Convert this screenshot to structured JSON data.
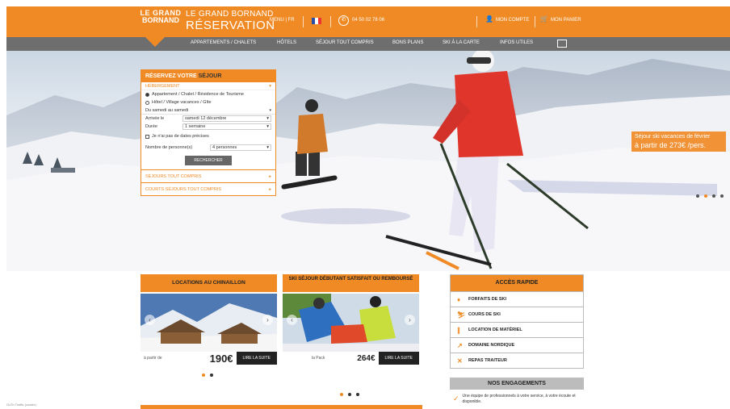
{
  "colors": {
    "accent": "#f08a24",
    "nav": "#6e6e6e",
    "dark": "#222222"
  },
  "header": {
    "logo_line1": "LE GRAND",
    "logo_line2": "BORNAND",
    "brand_line1": "LE GRAND BORNAND",
    "brand_line2": "RÉSERVATION",
    "lang_label": "MENU | FR",
    "phone_icon": "phone-icon",
    "phone": "04 50 02 78 06",
    "account_label": "MON COMPTE",
    "cart_label": "MON PANIER"
  },
  "nav": {
    "items": [
      "APPARTEMENTS / CHALETS",
      "HÔTELS",
      "SÉJOUR TOUT COMPRIS",
      "BONS PLANS",
      "SKI À LA CARTE",
      "INFOS UTILES"
    ]
  },
  "hero": {
    "promo_line1": "Séjour ski vacances de février",
    "promo_line2": "à partir de 273€ /pers.",
    "slides": 4,
    "active_slide": 2
  },
  "booking": {
    "title_prefix": "RÉSERVEZ VOTRE",
    "title_emph": "SÉJOUR",
    "section_label": "HÉBERGEMENT",
    "radio1": "Appartement / Chalet / Résidence de Tourisme",
    "radio2": "Hôtel / Village vacances / Gîte",
    "period_select": "Du samedi au samedi",
    "arrival_label": "Arrivée le",
    "arrival_value": "samedi 12 décembre",
    "duration_label": "Durée",
    "duration_value": "1 semaine",
    "dates_check": "Je n'ai pas de dates précises",
    "people_label": "Nombre de personne(s)",
    "people_value": "4 personnes",
    "search_button": "RECHERCHER",
    "link1": "SÉJOURS TOUT COMPRIS",
    "link2": "COURTS SÉJOURS TOUT COMPRIS"
  },
  "cards": [
    {
      "title": "LOCATIONS AU CHINAILLON",
      "price_prefix": "à partir de",
      "price": "190€",
      "read_more": "LIRE LA SUITE"
    },
    {
      "title": "SKI SÉJOUR DÉBUTANT SATISFAIT OU REMBOURSÉ",
      "price_prefix": "la Pack",
      "price": "264€",
      "read_more": "LIRE LA SUITE"
    }
  ],
  "quick_access": {
    "title": "ACCÈS RAPIDE",
    "items": [
      {
        "label": "FORFAITS DE SKI",
        "icon": "ski-pass-icon",
        "glyph": "♦"
      },
      {
        "label": "COURS DE SKI",
        "icon": "ski-lesson-icon",
        "glyph": "⛷"
      },
      {
        "label": "LOCATION DE MATÉRIEL",
        "icon": "ski-rental-icon",
        "glyph": "∥"
      },
      {
        "label": "DOMAINE NORDIQUE",
        "icon": "nordic-icon",
        "glyph": "↗"
      },
      {
        "label": "REPAS TRAITEUR",
        "icon": "catering-icon",
        "glyph": "✕"
      }
    ]
  },
  "engagements": {
    "title": "NOS ENGAGEMENTS",
    "text": "Une équipe de professionnels à votre service, à votre écoute et disponible."
  },
  "footer": {
    "small_text": "GoTo Traffic (cookie)"
  }
}
